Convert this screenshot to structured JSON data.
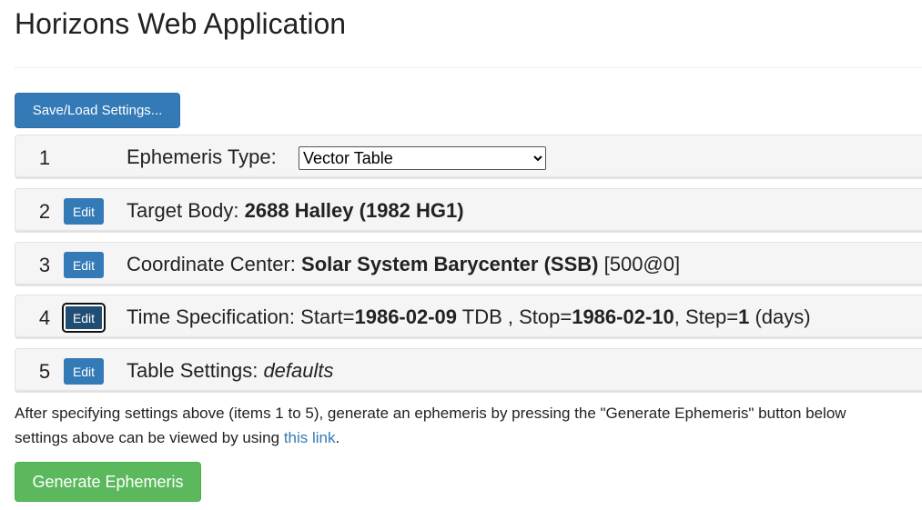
{
  "title": "Horizons Web Application",
  "save_load_label": "Save/Load Settings...",
  "rows": [
    {
      "num": "1",
      "label": "Ephemeris Type:",
      "select_value": "Vector Table"
    },
    {
      "num": "2",
      "edit": "Edit",
      "label": "Target Body:",
      "value": "2688 Halley (1982 HG1)"
    },
    {
      "num": "3",
      "edit": "Edit",
      "label": "Coordinate Center:",
      "value": "Solar System Barycenter (SSB)",
      "extra": "[500@0]"
    },
    {
      "num": "4",
      "edit": "Edit",
      "label": "Time Specification:",
      "start_label": "Start=",
      "start": "1986-02-09",
      "tdb": "TDB , Stop=",
      "stop": "1986-02-10",
      "step_label": ", Step=",
      "step": "1",
      "unit": "(days)"
    },
    {
      "num": "5",
      "edit": "Edit",
      "label": "Table Settings:",
      "value": "defaults"
    }
  ],
  "info_line1": "After specifying settings above (items 1 to 5), generate an ephemeris by pressing the \"Generate Ephemeris\" button below",
  "info_line2": "settings above can be viewed by using ",
  "link_text": "this link",
  "period": ".",
  "generate_label": "Generate Ephemeris"
}
